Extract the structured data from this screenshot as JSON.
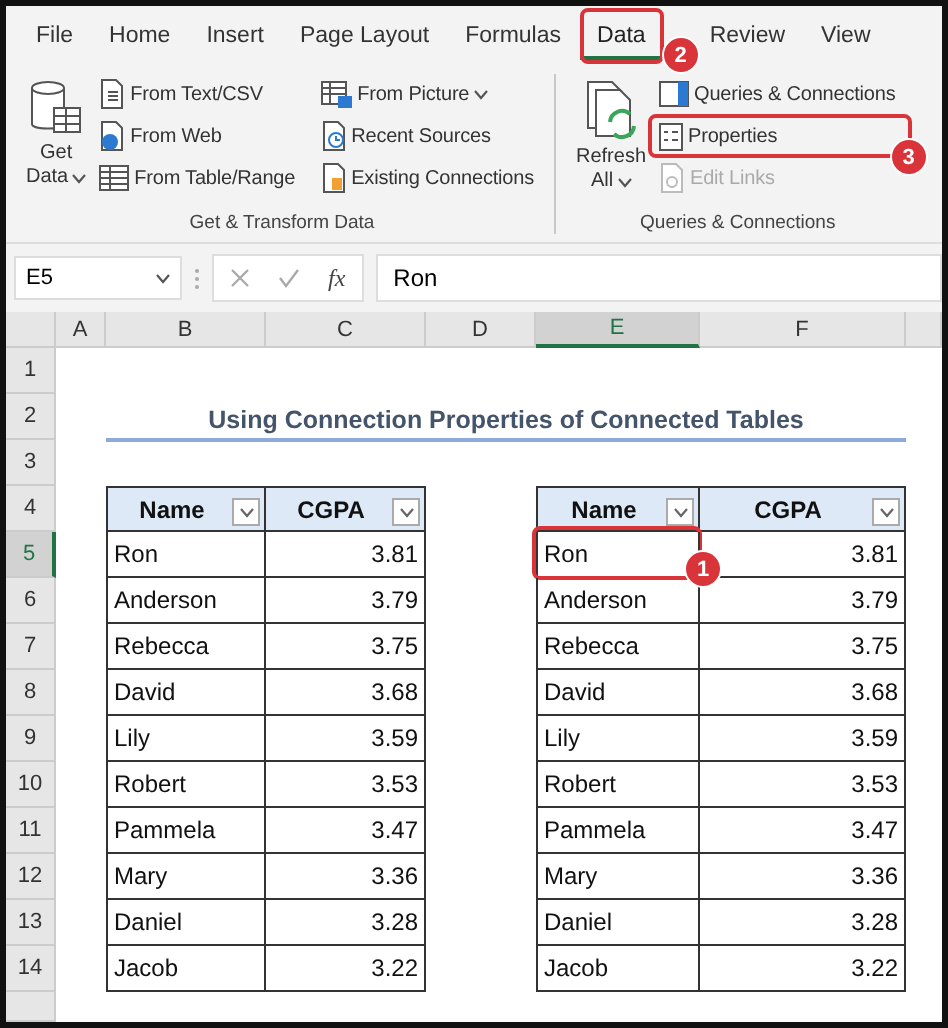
{
  "tabs": [
    {
      "label": "File",
      "selected": false
    },
    {
      "label": "Home",
      "selected": false
    },
    {
      "label": "Insert",
      "selected": false
    },
    {
      "label": "Page Layout",
      "selected": false
    },
    {
      "label": "Formulas",
      "selected": false
    },
    {
      "label": "Data",
      "selected": true,
      "callout": "2"
    },
    {
      "label": "Review",
      "selected": false
    },
    {
      "label": "View",
      "selected": false
    }
  ],
  "ribbon": {
    "groups": [
      {
        "label": "Get & Transform Data",
        "large": {
          "lines": [
            "Get",
            "Data"
          ],
          "dropdown": true,
          "kind": "database"
        },
        "columns": [
          [
            {
              "label": "From Text/CSV",
              "kind": "text-file",
              "dropdown": false,
              "disabled": false
            },
            {
              "label": "From Web",
              "kind": "web-file",
              "dropdown": false,
              "disabled": false
            },
            {
              "label": "From Table/Range",
              "kind": "table",
              "dropdown": false,
              "disabled": false
            }
          ],
          [
            {
              "label": "From Picture",
              "kind": "picture-table",
              "dropdown": true,
              "disabled": false
            },
            {
              "label": "Recent Sources",
              "kind": "clock-file",
              "dropdown": false,
              "disabled": false
            },
            {
              "label": "Existing Connections",
              "kind": "folder-file",
              "dropdown": false,
              "disabled": false
            }
          ]
        ]
      },
      {
        "label": "Queries & Connections",
        "large": {
          "lines": [
            "Refresh",
            "All"
          ],
          "dropdown": true,
          "kind": "refresh"
        },
        "columns": [
          [
            {
              "label": "Queries & Connections",
              "kind": "panel",
              "dropdown": false,
              "disabled": false
            },
            {
              "label": "Properties",
              "kind": "properties",
              "dropdown": false,
              "disabled": false,
              "callout": "3"
            },
            {
              "label": "Edit Links",
              "kind": "link-file",
              "dropdown": false,
              "disabled": true
            }
          ]
        ]
      }
    ]
  },
  "formula_bar": {
    "name_box": "E5",
    "function_label": "fx",
    "formula": "Ron"
  },
  "columns": [
    {
      "label": "A",
      "selected": false
    },
    {
      "label": "B",
      "selected": false
    },
    {
      "label": "C",
      "selected": false
    },
    {
      "label": "D",
      "selected": false
    },
    {
      "label": "E",
      "selected": true
    },
    {
      "label": "F",
      "selected": false
    }
  ],
  "rows": [
    {
      "label": "1",
      "selected": false
    },
    {
      "label": "2",
      "selected": false
    },
    {
      "label": "3",
      "selected": false
    },
    {
      "label": "4",
      "selected": false
    },
    {
      "label": "5",
      "selected": true
    },
    {
      "label": "6",
      "selected": false
    },
    {
      "label": "7",
      "selected": false
    },
    {
      "label": "8",
      "selected": false
    },
    {
      "label": "9",
      "selected": false
    },
    {
      "label": "10",
      "selected": false
    },
    {
      "label": "11",
      "selected": false
    },
    {
      "label": "12",
      "selected": false
    },
    {
      "label": "13",
      "selected": false
    },
    {
      "label": "14",
      "selected": false
    }
  ],
  "title": "Using Connection Properties of Connected Tables",
  "tables": [
    {
      "headers": [
        "Name",
        "CGPA"
      ],
      "rows": [
        {
          "name": "Ron",
          "cgpa": "3.81"
        },
        {
          "name": "Anderson",
          "cgpa": "3.79"
        },
        {
          "name": "Rebecca",
          "cgpa": "3.75"
        },
        {
          "name": "David",
          "cgpa": "3.68"
        },
        {
          "name": "Lily",
          "cgpa": "3.59"
        },
        {
          "name": "Robert",
          "cgpa": "3.53"
        },
        {
          "name": "Pammela",
          "cgpa": "3.47"
        },
        {
          "name": "Mary",
          "cgpa": "3.36"
        },
        {
          "name": "Daniel",
          "cgpa": "3.28"
        },
        {
          "name": "Jacob",
          "cgpa": "3.22"
        }
      ]
    },
    {
      "headers": [
        "Name",
        "CGPA"
      ],
      "rows": [
        {
          "name": "Ron",
          "cgpa": "3.81",
          "callout": "1"
        },
        {
          "name": "Anderson",
          "cgpa": "3.79"
        },
        {
          "name": "Rebecca",
          "cgpa": "3.75"
        },
        {
          "name": "David",
          "cgpa": "3.68"
        },
        {
          "name": "Lily",
          "cgpa": "3.59"
        },
        {
          "name": "Robert",
          "cgpa": "3.53"
        },
        {
          "name": "Pammela",
          "cgpa": "3.47"
        },
        {
          "name": "Mary",
          "cgpa": "3.36"
        },
        {
          "name": "Daniel",
          "cgpa": "3.28"
        },
        {
          "name": "Jacob",
          "cgpa": "3.22"
        }
      ]
    }
  ]
}
